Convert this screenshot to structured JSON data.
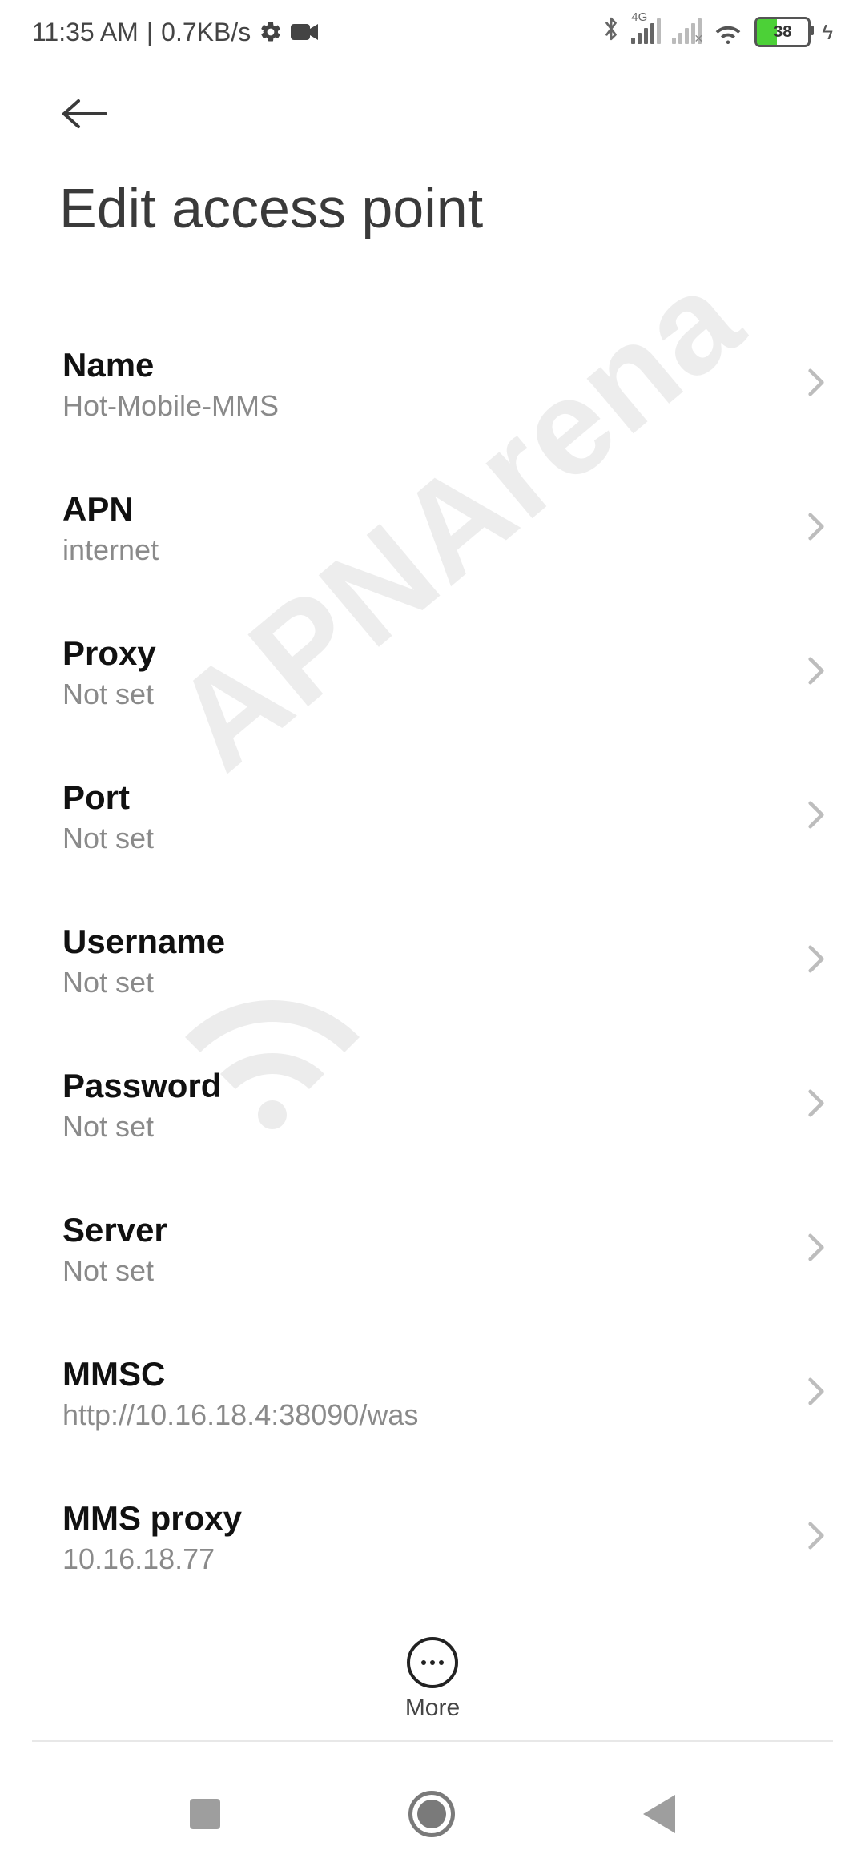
{
  "status": {
    "time": "11:35 AM",
    "separator": "|",
    "data_rate": "0.7KB/s",
    "network_label": "4G",
    "battery_percent": "38"
  },
  "header": {
    "title": "Edit access point"
  },
  "watermark": {
    "text": "APNArena"
  },
  "items": [
    {
      "title": "Name",
      "value": "Hot-Mobile-MMS"
    },
    {
      "title": "APN",
      "value": "internet"
    },
    {
      "title": "Proxy",
      "value": "Not set"
    },
    {
      "title": "Port",
      "value": "Not set"
    },
    {
      "title": "Username",
      "value": "Not set"
    },
    {
      "title": "Password",
      "value": "Not set"
    },
    {
      "title": "Server",
      "value": "Not set"
    },
    {
      "title": "MMSC",
      "value": "http://10.16.18.4:38090/was"
    },
    {
      "title": "MMS proxy",
      "value": "10.16.18.77"
    }
  ],
  "bottom": {
    "more_label": "More"
  }
}
